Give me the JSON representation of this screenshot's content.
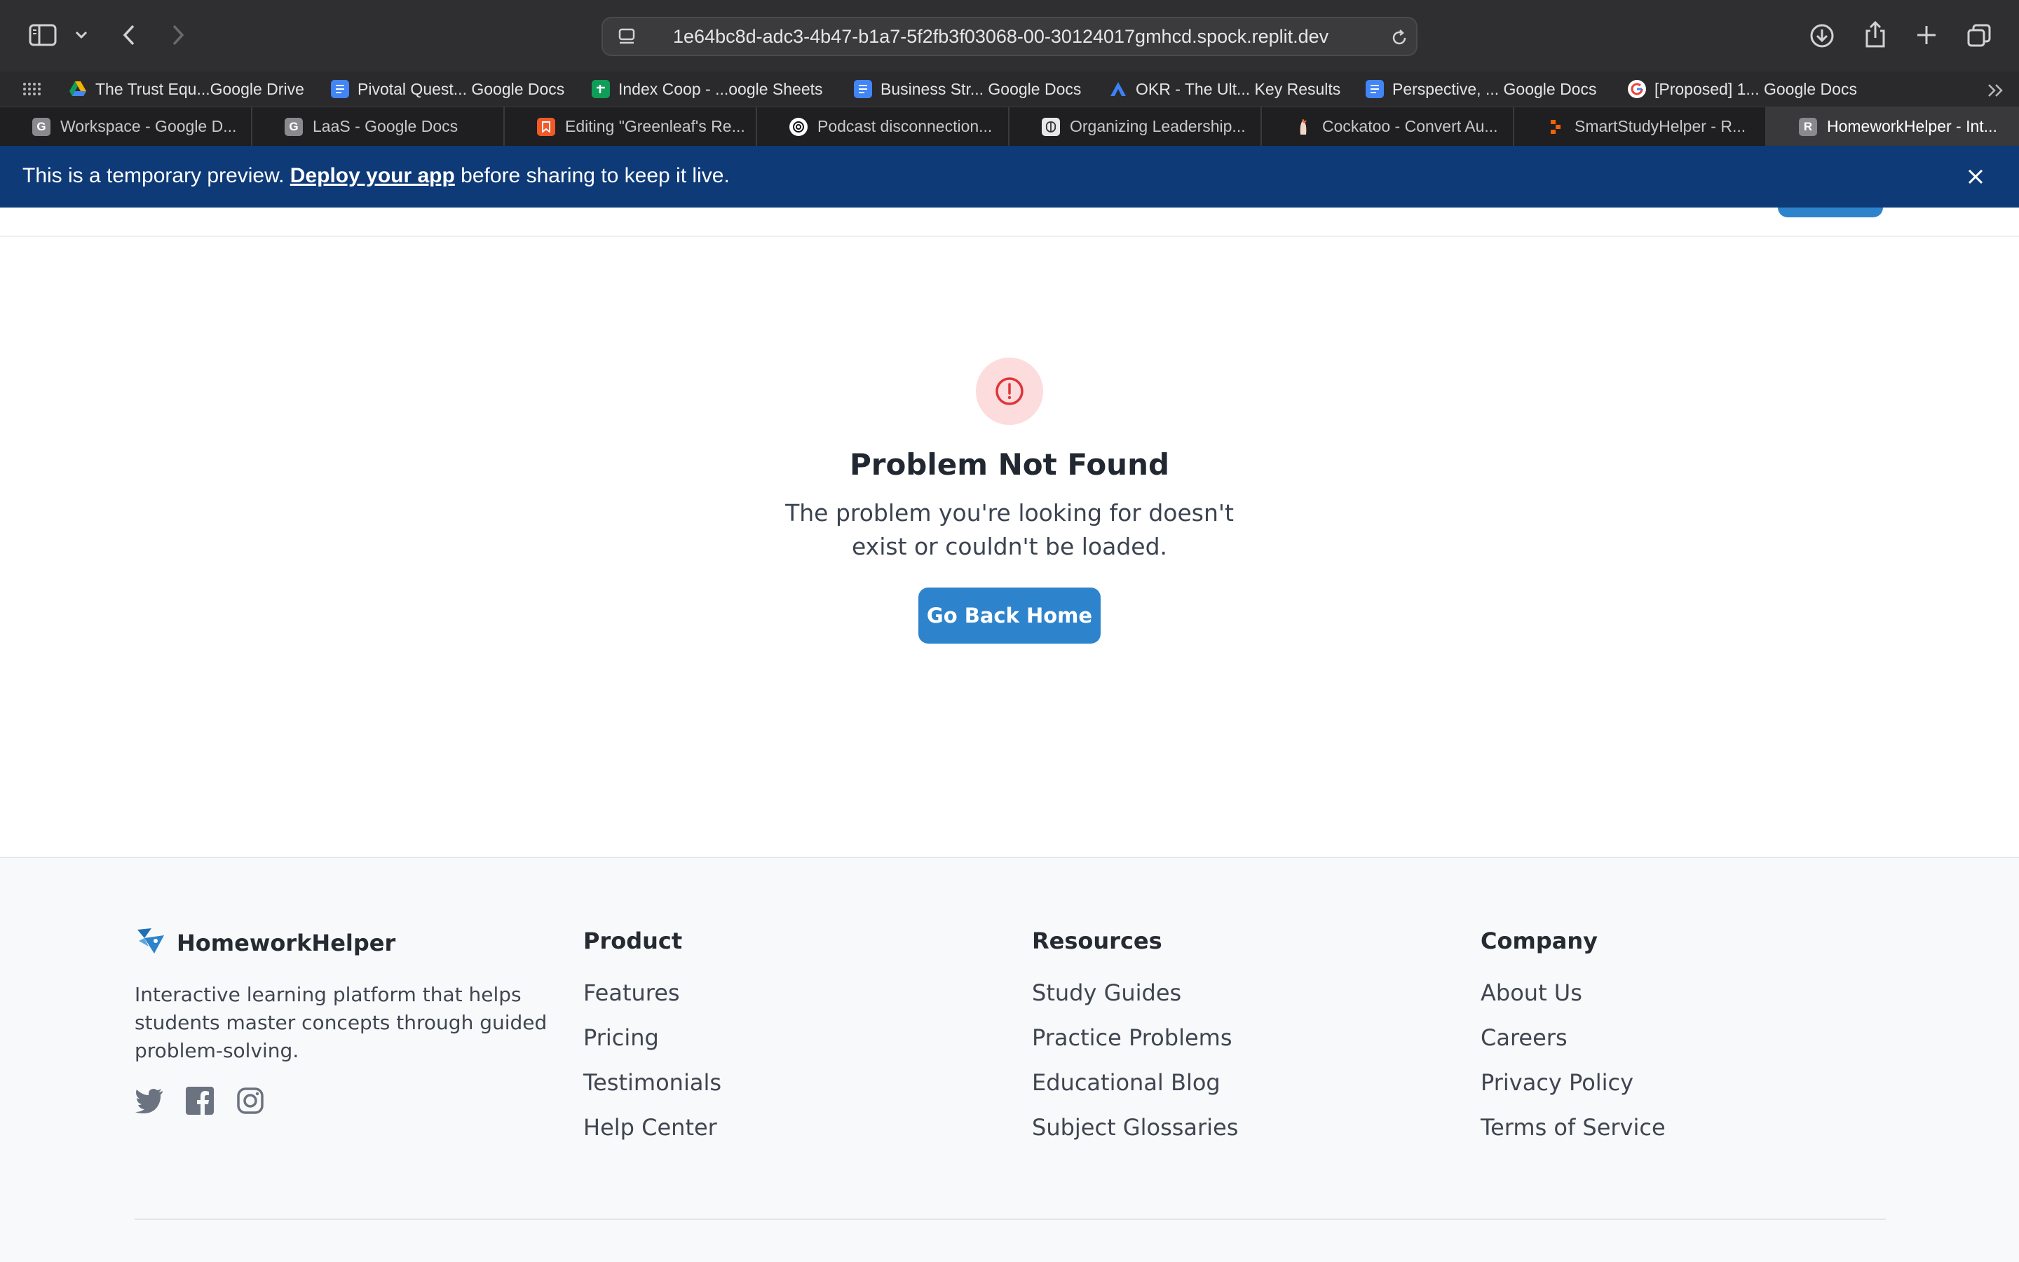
{
  "browser": {
    "url": "1e64bc8d-adc3-4b47-b1a7-5f2fb3f03068-00-30124017gmhcd.spock.replit.dev",
    "bookmarks": [
      {
        "label": "The Trust Equ...Google Drive",
        "icon": "google-drive-icon",
        "color": "#f4b400"
      },
      {
        "label": "Pivotal Quest... Google Docs",
        "icon": "google-docs-icon",
        "color": "#4285f4"
      },
      {
        "label": "Index Coop - ...oogle Sheets",
        "icon": "google-sheets-icon",
        "color": "#0f9d58"
      },
      {
        "label": "Business Str... Google Docs",
        "icon": "google-docs-icon",
        "color": "#4285f4"
      },
      {
        "label": "OKR - The Ult... Key Results",
        "icon": "okr-logo-icon",
        "color": "#3b82f6"
      },
      {
        "label": "Perspective, ... Google Docs",
        "icon": "google-docs-icon",
        "color": "#4285f4"
      },
      {
        "label": "[Proposed] 1... Google Docs",
        "icon": "google-g-icon",
        "color": "#ea4335"
      }
    ],
    "tabs": [
      {
        "label": "Workspace - Google D...",
        "icon_letter": "G",
        "icon": "g-letter-icon",
        "color": "#8a8a8e",
        "active": false
      },
      {
        "label": "LaaS - Google Docs",
        "icon_letter": "G",
        "icon": "g-letter-icon",
        "color": "#8a8a8e",
        "active": false
      },
      {
        "label": "Editing \"Greenleaf's Re...",
        "icon_letter": "",
        "icon": "bookmark-page-icon",
        "color": "#f05a28",
        "active": false
      },
      {
        "label": "Podcast disconnection...",
        "icon_letter": "",
        "icon": "openai-icon",
        "color": "#ffffff",
        "active": false
      },
      {
        "label": "Organizing Leadership...",
        "icon_letter": "",
        "icon": "brain-icon",
        "color": "#c8c8ca",
        "active": false
      },
      {
        "label": "Cockatoo - Convert Au...",
        "icon_letter": "",
        "icon": "cockatoo-icon",
        "color": "#e8623a",
        "active": false
      },
      {
        "label": "SmartStudyHelper - R...",
        "icon_letter": "",
        "icon": "replit-icon",
        "color": "#f26207",
        "active": false
      },
      {
        "label": "HomeworkHelper - Int...",
        "icon_letter": "R",
        "icon": "r-letter-icon",
        "color": "#8a8a8e",
        "active": true
      }
    ]
  },
  "banner": {
    "text_before": "This is a temporary preview. ",
    "link": "Deploy your app",
    "text_after": " before sharing to keep it live."
  },
  "not_found": {
    "title": "Problem Not Found",
    "message": "The problem you're looking for doesn't exist or couldn't be loaded.",
    "button": "Go Back Home"
  },
  "footer": {
    "brand": "HomeworkHelper",
    "tagline": "Interactive learning platform that helps students master concepts through guided problem-solving.",
    "socials": [
      "twitter-icon",
      "facebook-icon",
      "instagram-icon"
    ],
    "columns": [
      {
        "heading": "Product",
        "links": [
          "Features",
          "Pricing",
          "Testimonials",
          "Help Center"
        ]
      },
      {
        "heading": "Resources",
        "links": [
          "Study Guides",
          "Practice Problems",
          "Educational Blog",
          "Subject Glossaries"
        ]
      },
      {
        "heading": "Company",
        "links": [
          "About Us",
          "Careers",
          "Privacy Policy",
          "Terms of Service"
        ]
      }
    ]
  },
  "colors": {
    "banner": "#0e3a78",
    "primary_button": "#2e84cc",
    "alert_red": "#e0333a",
    "alert_bg": "#fcdcdc"
  }
}
